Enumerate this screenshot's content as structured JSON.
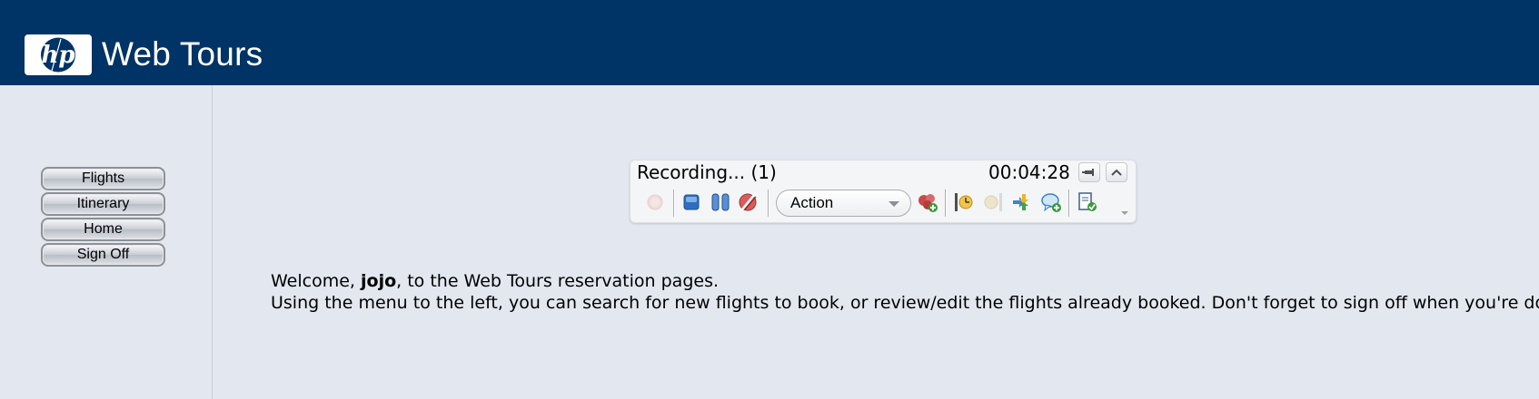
{
  "header": {
    "logo_icon": "hp-logo-icon",
    "brand": "Web Tours",
    "background_color": "#003366"
  },
  "sidebar": {
    "items": [
      {
        "label": "Flights"
      },
      {
        "label": "Itinerary"
      },
      {
        "label": "Home"
      },
      {
        "label": "Sign Off"
      }
    ]
  },
  "recorder": {
    "title": "Recording... (1)",
    "elapsed": "00:04:28",
    "action_select": "Action",
    "icons": [
      "record-icon",
      "stop-icon",
      "pause-icon",
      "discard-recording-icon",
      "create-action-icon",
      "insert-start-transaction-icon",
      "insert-end-transaction-icon",
      "insert-rendezvous-icon",
      "insert-comment-icon",
      "insert-text-check-icon",
      "pin-icon",
      "collapse-icon"
    ]
  },
  "welcome": {
    "greeting_prefix": "Welcome, ",
    "username": "jojo",
    "greeting_suffix": ", to the Web Tours reservation pages.",
    "instructions": "Using the menu to the left, you can search for new flights to book, or review/edit the flights already booked. Don't forget to sign off when you're done!"
  }
}
